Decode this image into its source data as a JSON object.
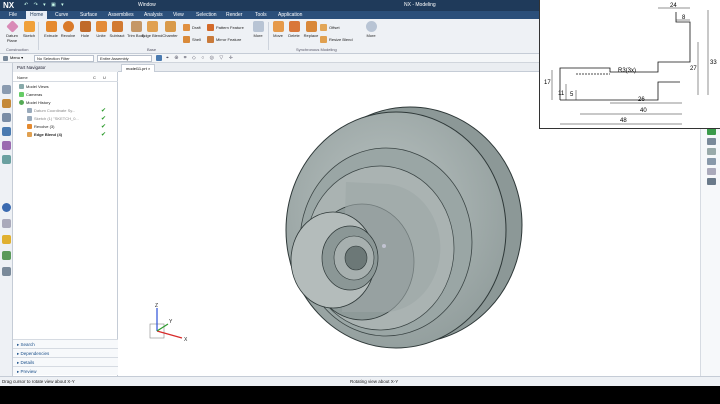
{
  "app": {
    "logo": "NX",
    "window_menu": "Window",
    "title": "NX - Modeling",
    "quick_access": "↶ ↷ ▾ ▣ ▾"
  },
  "menu": [
    "File",
    "Home",
    "Curve",
    "Surface",
    "Assemblies",
    "Analysis",
    "View",
    "Selection",
    "Render",
    "Tools",
    "Application"
  ],
  "ribbon": {
    "buttons": [
      {
        "label": "Datum Plane",
        "icon": "datum-plane-icon",
        "color": "#d98bb7"
      },
      {
        "label": "Sketch",
        "icon": "sketch-icon",
        "color": "#f0a13a"
      },
      {
        "label": "Extrude",
        "icon": "extrude-icon",
        "color": "#e58a2f"
      },
      {
        "label": "Revolve",
        "icon": "revolve-icon",
        "color": "#d97a2a"
      },
      {
        "label": "Hole",
        "icon": "hole-icon",
        "color": "#c06a2a"
      },
      {
        "label": "Unite",
        "icon": "unite-icon",
        "color": "#e38b38"
      },
      {
        "label": "Subtract",
        "icon": "subtract-icon",
        "color": "#d27a32"
      },
      {
        "label": "Trim Body",
        "icon": "trim-body-icon",
        "color": "#c59766"
      },
      {
        "label": "Edge Blend",
        "icon": "edge-blend-icon",
        "color": "#e0a050"
      },
      {
        "label": "Chamfer",
        "icon": "chamfer-icon",
        "color": "#d99a4a"
      }
    ],
    "small_buttons": [
      {
        "label": "Draft",
        "icon": "draft-icon",
        "color": "#e09040"
      },
      {
        "label": "Shell",
        "icon": "shell-icon",
        "color": "#d98a3a"
      },
      {
        "label": "Pattern Feature",
        "icon": "pattern-feature-icon",
        "color": "#d36a2a"
      },
      {
        "label": "Mirror Feature",
        "icon": "mirror-feature-icon",
        "color": "#c97a3a"
      }
    ],
    "more_label": "More",
    "sync_buttons": [
      {
        "label": "Move",
        "icon": "move-face-icon",
        "color": "#e69a4a"
      },
      {
        "label": "Delete",
        "icon": "delete-face-icon",
        "color": "#d9773a"
      },
      {
        "label": "Replace",
        "icon": "replace-face-icon",
        "color": "#d9883a"
      },
      {
        "label": "Resize Blend",
        "icon": "resize-blend-icon",
        "color": "#e0a050"
      }
    ],
    "offset_label": "Offset",
    "groups": [
      "Construction",
      "Base",
      "Synchronous Modeling"
    ]
  },
  "toolbar2": {
    "menu_label": "Menu ▾",
    "filter": "No Selection Filter",
    "scope": "Entire Assembly"
  },
  "part_tab": {
    "label": "model11.prt"
  },
  "navigator": {
    "title": "Part Navigator",
    "columns": [
      "Name",
      "C",
      "U"
    ],
    "rows": [
      {
        "label": "Model Views",
        "indent": 6,
        "icon_color": "#8aa"
      },
      {
        "label": "Cameras",
        "indent": 6,
        "icon_color": "#6c6"
      },
      {
        "label": "Model History",
        "indent": 6,
        "icon_color": "#5a5"
      },
      {
        "label": "Datum Coordinate Sy...",
        "indent": 14,
        "icon_color": "#9ab",
        "check": "✔",
        "dim": true
      },
      {
        "label": "Sketch (1) \"SKETCH_0...",
        "indent": 14,
        "icon_color": "#9ab",
        "check": "✔",
        "dim": true
      },
      {
        "label": "Revolve (3)",
        "indent": 14,
        "icon_color": "#e58a2f",
        "check": "✔"
      },
      {
        "label": "Edge Blend (4)",
        "indent": 14,
        "icon_color": "#e0a050",
        "check": "✔",
        "bold": true
      }
    ],
    "accordion": [
      "Search",
      "Dependencies",
      "Details",
      "Preview"
    ]
  },
  "status": {
    "left": "Drag cursor to rotate view about X-Y",
    "center": "Rotating view about X-Y"
  },
  "sketch_dims": [
    "24",
    "8",
    "33",
    "27",
    "17",
    "11",
    "5",
    "R3(3x)",
    "26",
    "40",
    "48"
  ],
  "triad": {
    "x": "X",
    "y": "Y",
    "z": "Z"
  }
}
